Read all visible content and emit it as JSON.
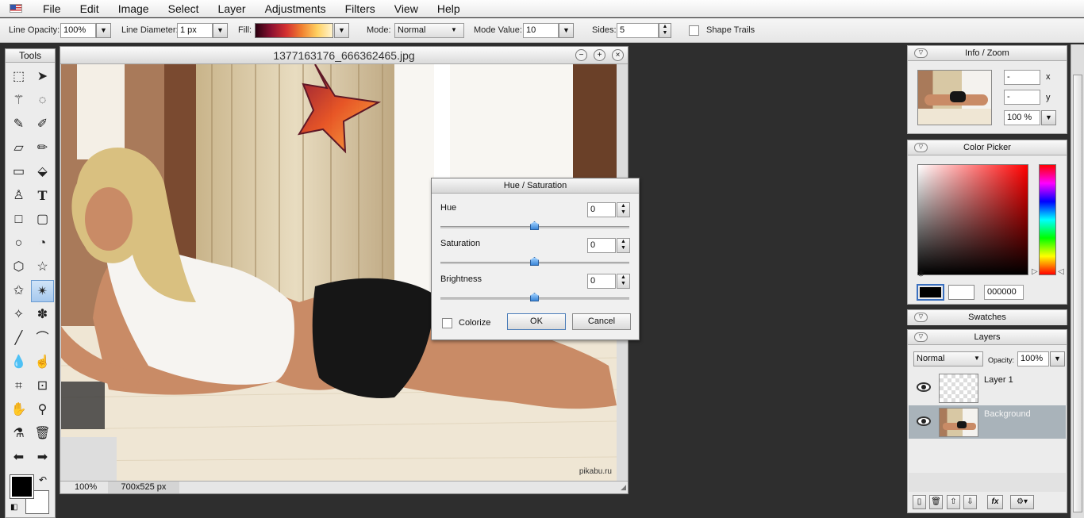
{
  "menubar": {
    "items": [
      "File",
      "Edit",
      "Image",
      "Select",
      "Layer",
      "Adjustments",
      "Filters",
      "View",
      "Help"
    ]
  },
  "toolbar": {
    "line_opacity_label": "Line Opacity:",
    "line_opacity_value": "100%",
    "line_diameter_label": "Line Diameter:",
    "line_diameter_value": "1 px",
    "fill_label": "Fill:",
    "mode_label": "Mode:",
    "mode_value": "Normal",
    "mode_value_label": "Mode Value:",
    "mode_value_value": "10",
    "sides_label": "Sides:",
    "sides_value": "5",
    "shape_trails_label": "Shape Trails",
    "shape_trails_checked": false
  },
  "tools": {
    "title": "Tools",
    "active": "polygon-star-tool"
  },
  "image_window": {
    "title": "1377163176_666362465.jpg",
    "zoom": "100%",
    "size": "700x525 px",
    "watermark": "pikabu.ru"
  },
  "dialog": {
    "title": "Hue / Saturation",
    "hue_label": "Hue",
    "hue_value": "0",
    "saturation_label": "Saturation",
    "saturation_value": "0",
    "brightness_label": "Brightness",
    "brightness_value": "0",
    "colorize_label": "Colorize",
    "colorize_checked": false,
    "ok_label": "OK",
    "cancel_label": "Cancel"
  },
  "info_panel": {
    "title": "Info / Zoom",
    "x_value": "-",
    "x_label": "x",
    "y_value": "-",
    "y_label": "y",
    "zoom_value": "100 %"
  },
  "color_picker": {
    "title": "Color Picker",
    "hex_value": "000000",
    "primary_color": "#000000",
    "secondary_color": "#ffffff"
  },
  "swatches": {
    "title": "Swatches"
  },
  "layers": {
    "title": "Layers",
    "blend_mode": "Normal",
    "opacity_label": "Opacity:",
    "opacity_value": "100%",
    "items": [
      {
        "name": "Layer 1"
      },
      {
        "name": "Background"
      }
    ]
  }
}
